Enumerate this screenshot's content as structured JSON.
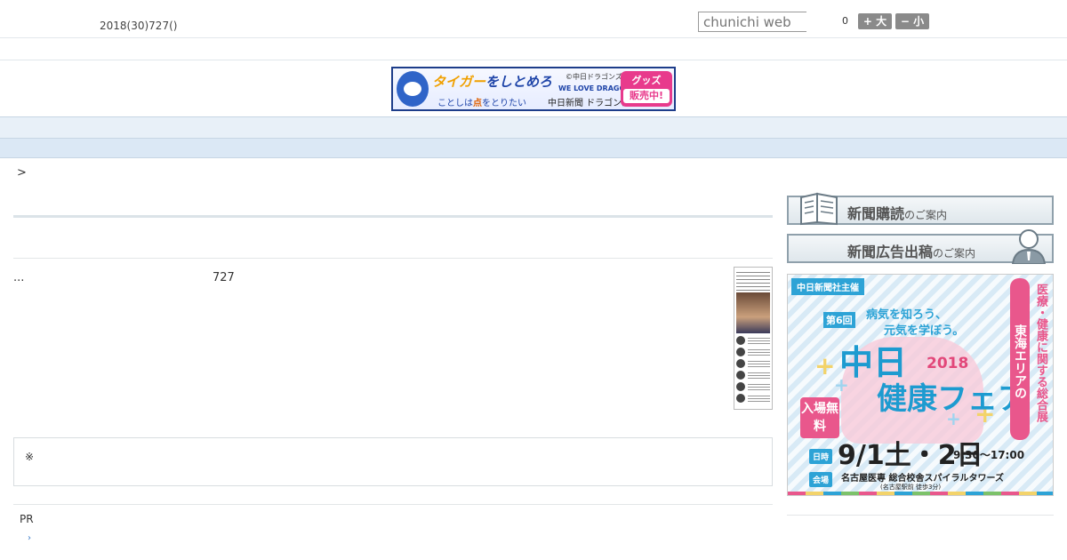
{
  "header": {
    "date": "2018(30)727()",
    "search_placeholder": "chunichi web",
    "count": "0",
    "font_plus": "+ 大",
    "font_minus": "− 小"
  },
  "banner": {
    "line1_pre": "タイガー",
    "line1_post": "をしとめろ",
    "copyright": "©中日ドラゴンズ",
    "slogan": "WE LOVE DRAGONS",
    "line2_pre": "ことしは",
    "line2_point": "点",
    "line2_post": "をとりたい",
    "shop": "中日新聞 ドラゴンズショップ",
    "badge1": "グッズ",
    "badge2": "販売中!"
  },
  "nav": {
    "items": [
      "",
      "",
      "",
      "",
      "",
      "",
      "",
      "",
      ""
    ]
  },
  "main": {
    "breadcrumb": ">",
    "body_text": "...",
    "body_number": "727",
    "note_mark": "※",
    "pr_label": "PR",
    "pr_arrow": "›"
  },
  "sidebar": {
    "subscribe_main": "新聞購読",
    "subscribe_sub": "のご案内",
    "ad_main": "新聞広告出稿",
    "ad_sub": "のご案内",
    "fair": {
      "organizer": "中日新聞社主催",
      "edition": "第6回",
      "catch1": "病気を知ろう、",
      "catch2": "元気を学ぼう。",
      "title1": "中日",
      "year": "2018",
      "title2": "健康フェア",
      "free": "入場無料",
      "vertical1": "東海エリアの",
      "vertical2": "医療・健康に関する総合展",
      "date_label": "日時",
      "date": "9/1土・2日",
      "time": "9:30〜17:00",
      "venue_label": "会場",
      "venue": "名古屋医専 総合校舎スパイラルタワーズ",
      "access": "(名古屋駅前 徒歩3分)"
    }
  },
  "colors": {
    "nav_bg": "#e8f0f8",
    "subnav_bg": "#dbe8f5",
    "fair_blue": "#2da3d6",
    "fair_pink": "#e9578c"
  }
}
